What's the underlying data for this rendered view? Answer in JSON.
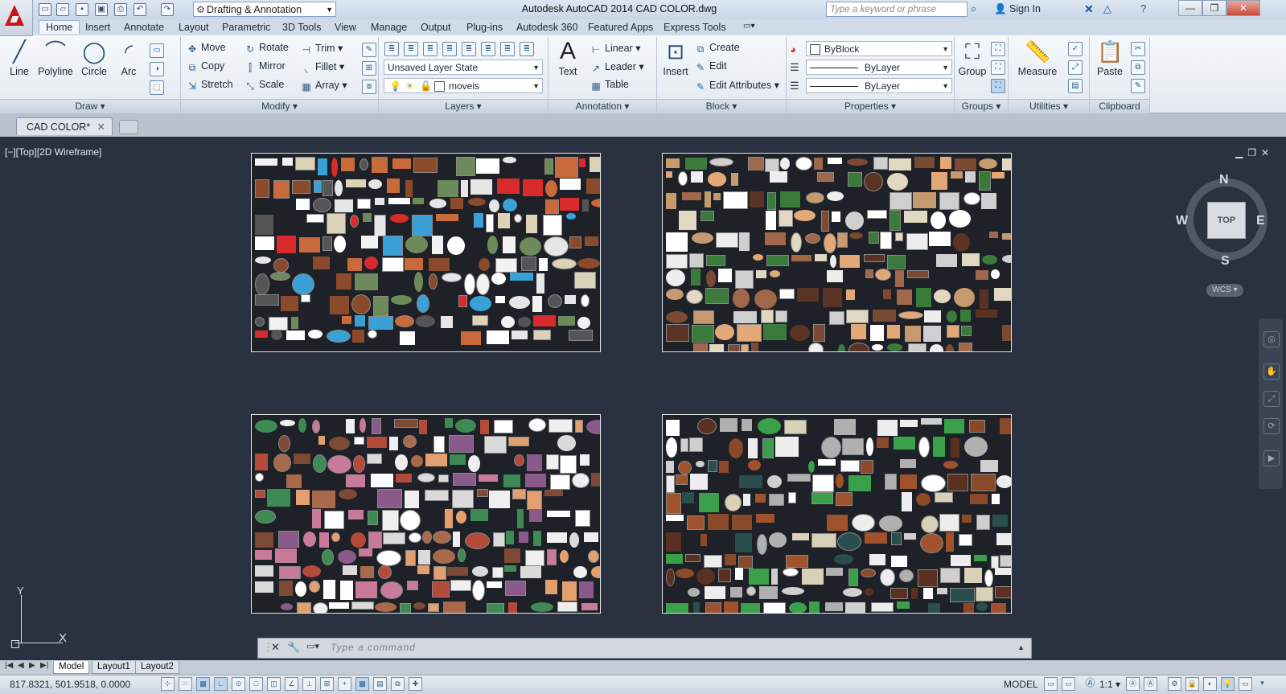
{
  "app": {
    "title": "Autodesk AutoCAD 2014    CAD COLOR.dwg",
    "workspace": "Drafting & Annotation",
    "search_placeholder": "Type a keyword or phrase",
    "sign_in": "Sign In"
  },
  "menu_tabs": [
    "Home",
    "Insert",
    "Annotate",
    "Layout",
    "Parametric",
    "3D Tools",
    "View",
    "Manage",
    "Output",
    "Plug-ins",
    "Autodesk 360",
    "Featured Apps",
    "Express Tools"
  ],
  "ribbon": {
    "draw": {
      "title": "Draw",
      "line": "Line",
      "polyline": "Polyline",
      "circle": "Circle",
      "arc": "Arc"
    },
    "modify": {
      "title": "Modify",
      "move": "Move",
      "rotate": "Rotate",
      "trim": "Trim",
      "copy": "Copy",
      "mirror": "Mirror",
      "fillet": "Fillet",
      "stretch": "Stretch",
      "scale": "Scale",
      "array": "Array"
    },
    "layers": {
      "title": "Layers",
      "layer_state": "Unsaved Layer State",
      "current_layer": "moveis"
    },
    "annotation": {
      "title": "Annotation",
      "text": "Text",
      "linear": "Linear",
      "leader": "Leader",
      "table": "Table"
    },
    "block": {
      "title": "Block",
      "insert": "Insert",
      "create": "Create",
      "edit": "Edit",
      "edit_attributes": "Edit Attributes"
    },
    "properties": {
      "title": "Properties",
      "color": "ByBlock",
      "linetype": "ByLayer",
      "lineweight": "ByLayer"
    },
    "groups": {
      "title": "Groups",
      "group": "Group"
    },
    "utilities": {
      "title": "Utilities",
      "measure": "Measure"
    },
    "clipboard": {
      "title": "Clipboard",
      "paste": "Paste"
    }
  },
  "file_tab": "CAD COLOR*",
  "viewport": {
    "label": "[−][Top][2D Wireframe]",
    "viewcube": {
      "top": "TOP",
      "n": "N",
      "s": "S",
      "e": "E",
      "w": "W",
      "wcs": "WCS"
    },
    "ucs": {
      "x": "X",
      "y": "Y"
    }
  },
  "command_line": {
    "placeholder": "Type  a  command"
  },
  "layout_tabs": [
    "Model",
    "Layout1",
    "Layout2"
  ],
  "status": {
    "coords": "817.8321, 501.9518, 0.0000",
    "model": "MODEL",
    "scale": "1:1"
  },
  "colors": {
    "accent": "#c8171a",
    "canvas": "#2a3140"
  }
}
